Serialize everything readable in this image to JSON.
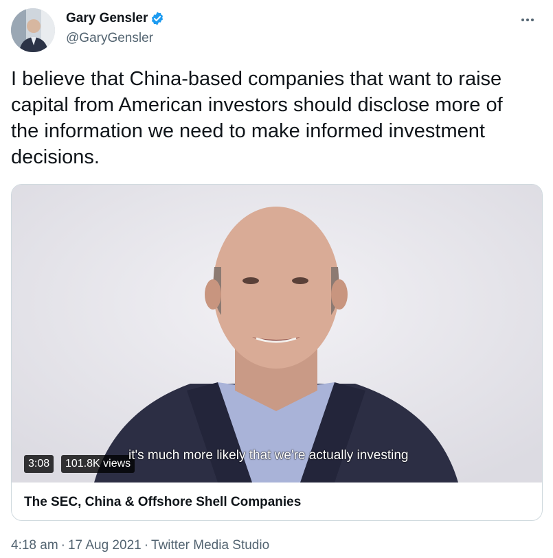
{
  "author": {
    "name": "Gary Gensler",
    "handle": "@GaryGensler",
    "verified_color": "#1d9bf0"
  },
  "tweet": {
    "text": "I believe that China-based companies that want to raise capital from American investors should disclose more of the information we need to make informed investment decisions."
  },
  "media": {
    "duration": "3:08",
    "views": "101.8K views",
    "caption": "it's much more likely that we're actually investing",
    "title": "The SEC, China & Offshore Shell Companies"
  },
  "meta": {
    "time": "4:18 am",
    "date": "17 Aug 2021",
    "source": "Twitter Media Studio"
  },
  "icons": [
    "verified-badge-icon",
    "more-options-icon"
  ]
}
